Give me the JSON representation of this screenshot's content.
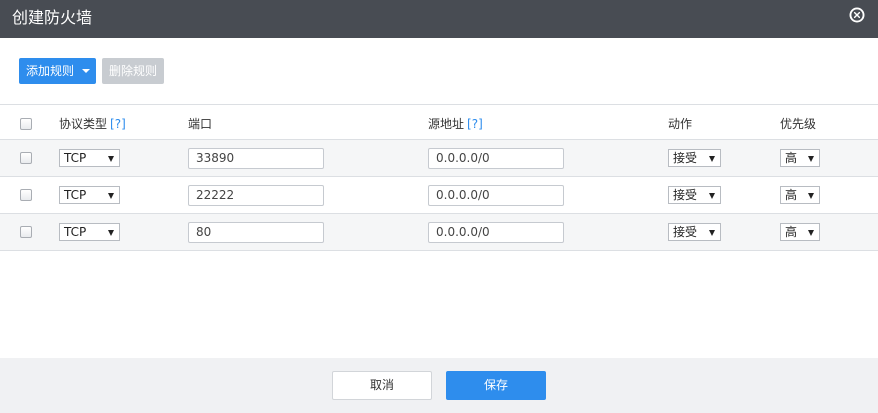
{
  "dialog": {
    "title": "创建防火墙"
  },
  "toolbar": {
    "add_label": "添加规则",
    "delete_label": "删除规则"
  },
  "table": {
    "headers": {
      "protocol": "协议类型",
      "protocol_help": "[?]",
      "port": "端口",
      "source": "源地址",
      "source_help": "[?]",
      "action": "动作",
      "priority": "优先级"
    },
    "rows": [
      {
        "protocol": "TCP",
        "port": "33890",
        "source": "0.0.0.0/0",
        "action": "接受",
        "priority": "高"
      },
      {
        "protocol": "TCP",
        "port": "22222",
        "source": "0.0.0.0/0",
        "action": "接受",
        "priority": "高"
      },
      {
        "protocol": "TCP",
        "port": "80",
        "source": "0.0.0.0/0",
        "action": "接受",
        "priority": "高"
      }
    ]
  },
  "footer": {
    "cancel_label": "取消",
    "save_label": "保存"
  },
  "colors": {
    "titlebar": "#484c53",
    "accent": "#2e8ded",
    "disabled": "#c8ccd1",
    "footer": "#f0f1f3"
  },
  "icons": {
    "close": "close-circle-icon",
    "add_dropdown": "caret-down-icon",
    "select_arrow": "triangle-down-icon"
  }
}
